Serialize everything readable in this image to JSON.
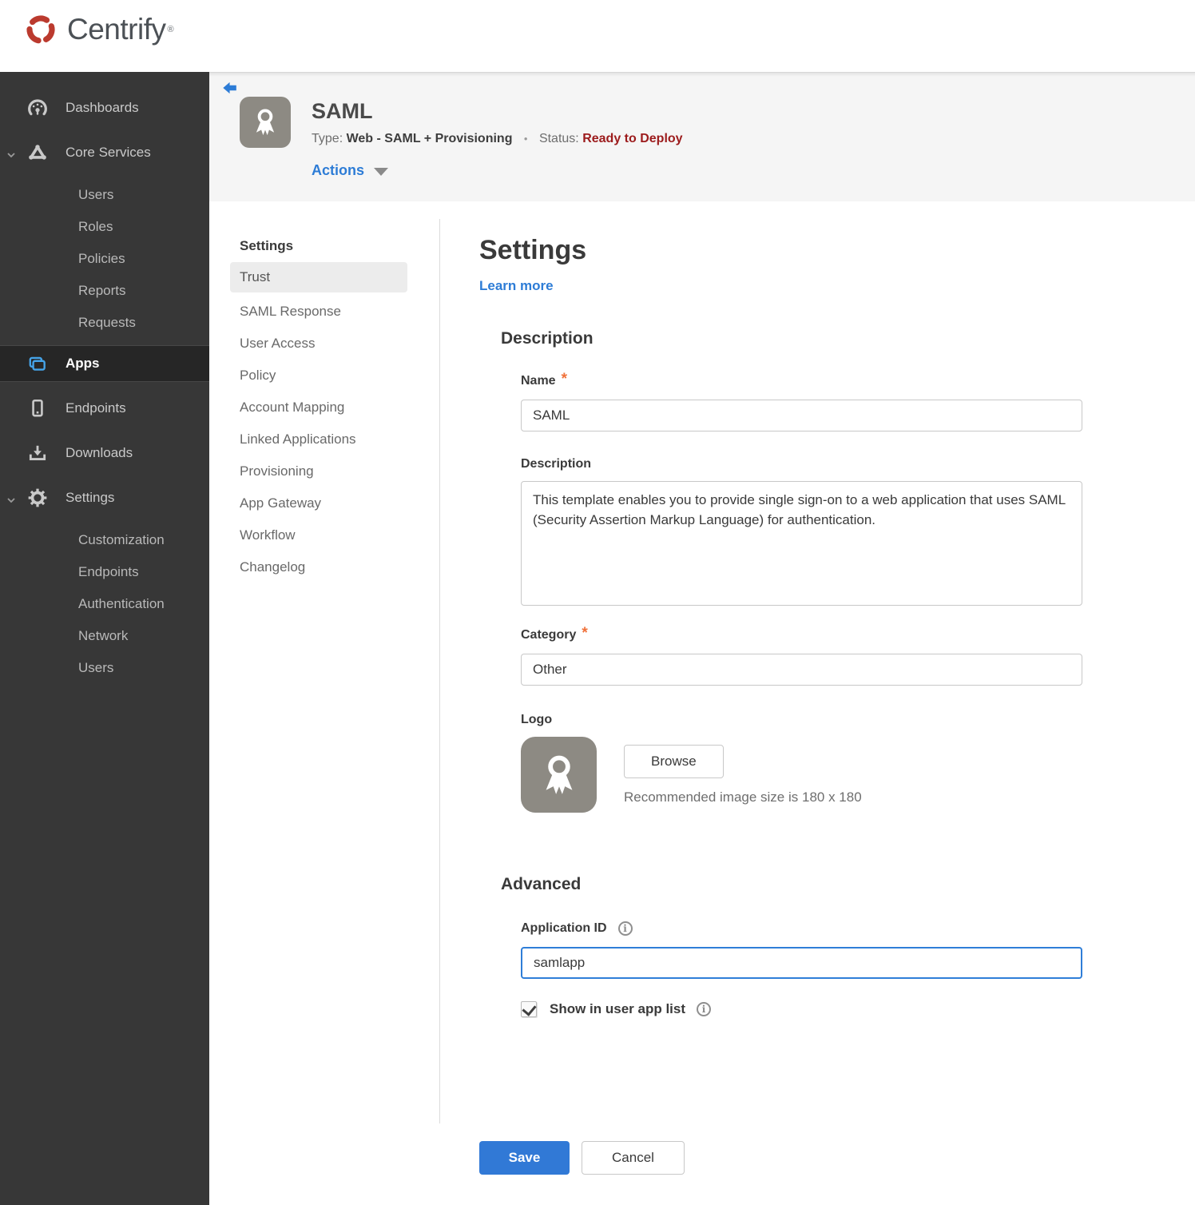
{
  "topbar": {
    "brand": "Centrify",
    "trademark": "®"
  },
  "sidebar": {
    "dashboards": {
      "label": "Dashboards"
    },
    "core_services": {
      "label": "Core Services",
      "expanded": true,
      "children": [
        "Users",
        "Roles",
        "Policies",
        "Reports",
        "Requests"
      ]
    },
    "apps": {
      "label": "Apps",
      "active": true
    },
    "endpoints": {
      "label": "Endpoints"
    },
    "downloads": {
      "label": "Downloads"
    },
    "settings": {
      "label": "Settings",
      "expanded": true,
      "children": [
        "Customization",
        "Endpoints",
        "Authentication",
        "Network",
        "Users"
      ]
    }
  },
  "header": {
    "app_title": "SAML",
    "type_label": "Type:",
    "type_value": "Web - SAML + Provisioning",
    "separator": "•",
    "status_label": "Status:",
    "status_value": "Ready to Deploy",
    "actions_label": "Actions"
  },
  "subnav": {
    "header": "Settings",
    "active_item": "Trust",
    "items": [
      "Trust",
      "SAML Response",
      "User Access",
      "Policy",
      "Account Mapping",
      "Linked Applications",
      "Provisioning",
      "App Gateway",
      "Workflow",
      "Changelog"
    ]
  },
  "main": {
    "title": "Settings",
    "learn_more": "Learn more",
    "required_marker": "*",
    "description_section": {
      "heading": "Description",
      "name_label": "Name",
      "name_value": "SAML",
      "description_label": "Description",
      "description_value": "This template enables you to provide single sign-on to a web application that uses SAML (Security Assertion Markup Language) for authentication.",
      "category_label": "Category",
      "category_value": "Other",
      "logo_label": "Logo",
      "browse_button": "Browse",
      "logo_hint": "Recommended image size is 180 x 180"
    },
    "advanced_section": {
      "heading": "Advanced",
      "application_id_label": "Application ID",
      "application_id_value": "samlapp",
      "show_in_user_app_list_label": "Show in user app list",
      "show_in_user_app_list_checked": true
    },
    "footer": {
      "save_button": "Save",
      "cancel_button": "Cancel"
    }
  },
  "icons": {
    "info_glyph": "i"
  },
  "colors": {
    "brand_red": "#bb3a2e",
    "accent_blue": "#2d7cd6",
    "status_red": "#9c1b1c",
    "save_button_blue": "#3179d6",
    "apps_icon_blue": "#45a3e8",
    "focus_border_blue": "#2f7ed8",
    "sidebar_bg": "#373737",
    "header_bg": "#f5f5f5"
  }
}
